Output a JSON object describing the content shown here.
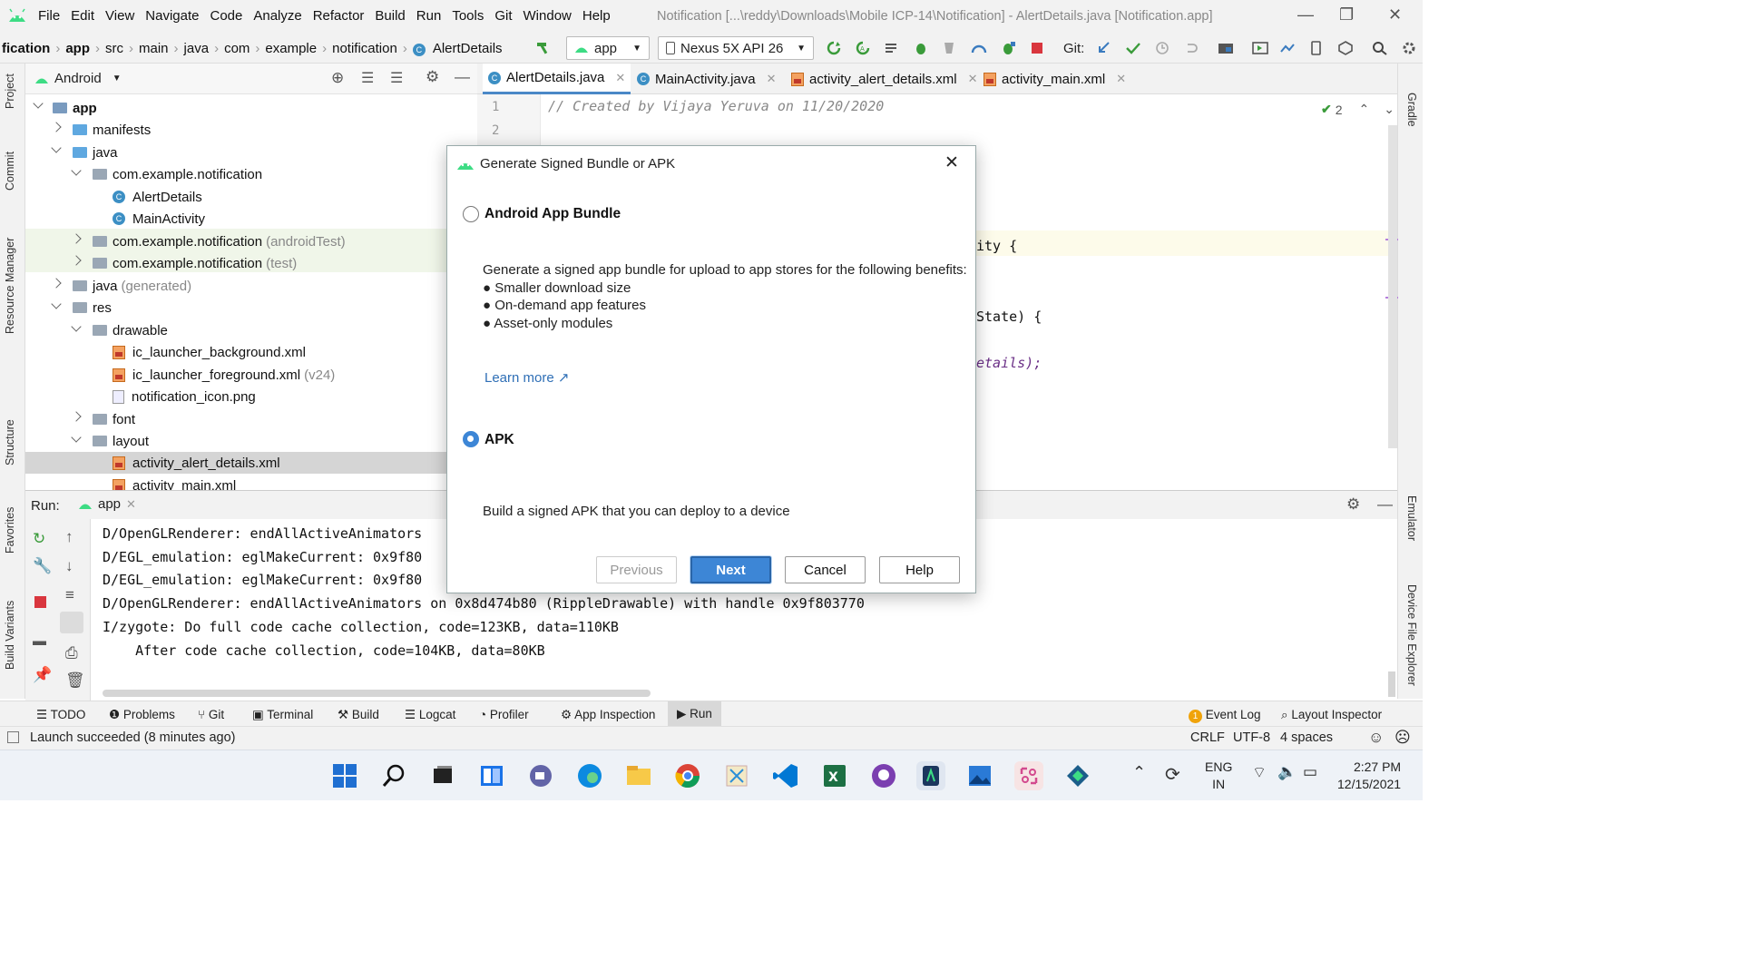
{
  "menubar": {
    "items": [
      "File",
      "Edit",
      "View",
      "Navigate",
      "Code",
      "Analyze",
      "Refactor",
      "Build",
      "Run",
      "Tools",
      "Git",
      "Window",
      "Help"
    ],
    "title": "Notification [...\\reddy\\Downloads\\Mobile ICP-14\\Notification] - AlertDetails.java [Notification.app]"
  },
  "navbar": {
    "breadcrumbs": [
      "fication",
      "app",
      "src",
      "main",
      "java",
      "com",
      "example",
      "notification",
      "AlertDetails"
    ],
    "run_config": "app",
    "device": "Nexus 5X API 26",
    "git_label": "Git:"
  },
  "left_strip": [
    "Project",
    "Commit",
    "Resource Manager",
    "Structure",
    "Favorites",
    "Build Variants"
  ],
  "right_strip": [
    "Gradle",
    "Emulator",
    "Device File Explorer"
  ],
  "project": {
    "view": "Android",
    "tree": [
      {
        "label": "app",
        "type": "module",
        "bold": true
      },
      {
        "label": "manifests",
        "type": "folder"
      },
      {
        "label": "java",
        "type": "folder"
      },
      {
        "label": "com.example.notification",
        "type": "package"
      },
      {
        "label": "AlertDetails",
        "type": "class"
      },
      {
        "label": "MainActivity",
        "type": "class"
      },
      {
        "label": "com.example.notification",
        "suffix": "(androidTest)",
        "type": "package"
      },
      {
        "label": "com.example.notification",
        "suffix": "(test)",
        "type": "package"
      },
      {
        "label": "java",
        "suffix": "(generated)",
        "type": "folder"
      },
      {
        "label": "res",
        "type": "folder"
      },
      {
        "label": "drawable",
        "type": "folder"
      },
      {
        "label": "ic_launcher_background.xml",
        "type": "xml"
      },
      {
        "label": "ic_launcher_foreground.xml",
        "suffix": "(v24)",
        "type": "xml"
      },
      {
        "label": "notification_icon.png",
        "type": "png"
      },
      {
        "label": "font",
        "type": "folder"
      },
      {
        "label": "layout",
        "type": "folder"
      },
      {
        "label": "activity_alert_details.xml",
        "type": "xml"
      },
      {
        "label": "activity_main.xml",
        "type": "xml"
      }
    ]
  },
  "editor": {
    "tabs": [
      "AlertDetails.java",
      "MainActivity.java",
      "activity_alert_details.xml",
      "activity_main.xml"
    ],
    "line_numbers": [
      "1",
      "2"
    ],
    "comment": "// Created by Vijaya Yeruva on 11/20/2020",
    "visible_fragments": [
      "ity {",
      "State) {",
      "etails);"
    ],
    "problems_count": "2"
  },
  "run": {
    "label": "Run:",
    "config": "app",
    "lines": [
      "D/OpenGLRenderer: endAllActiveAnimators",
      "D/EGL_emulation: eglMakeCurrent: 0x9f80",
      "D/EGL_emulation: eglMakeCurrent: 0x9f80",
      "D/OpenGLRenderer: endAllActiveAnimators on 0x8d474b80 (RippleDrawable) with handle 0x9f803770",
      "I/zygote: Do full code cache collection, code=123KB, data=110KB",
      "    After code cache collection, code=104KB, data=80KB"
    ]
  },
  "tool_windows": [
    "TODO",
    "Problems",
    "Git",
    "Terminal",
    "Build",
    "Logcat",
    "Profiler",
    "App Inspection",
    "Run"
  ],
  "tool_windows_right": {
    "event_log": "Event Log",
    "event_count": "1",
    "layout_inspector": "Layout Inspector"
  },
  "status": {
    "message": "Launch succeeded (8 minutes ago)",
    "line_sep": "CRLF",
    "encoding": "UTF-8",
    "indent": "4 spaces"
  },
  "dialog": {
    "title": "Generate Signed Bundle or APK",
    "option1_label": "Android App Bundle",
    "option1_desc": "Generate a signed app bundle for upload to app stores for the following benefits:",
    "benefits": [
      "Smaller download size",
      "On-demand app features",
      "Asset-only modules"
    ],
    "learn_more": "Learn more ↗",
    "option2_label": "APK",
    "option2_desc": "Build a signed APK that you can deploy to a device",
    "selected": "APK",
    "buttons": {
      "previous": "Previous",
      "next": "Next",
      "cancel": "Cancel",
      "help": "Help"
    }
  },
  "taskbar": {
    "lang": "ENG",
    "region": "IN",
    "time": "2:27 PM",
    "date": "12/15/2021"
  },
  "colors": {
    "accent": "#3d86d6",
    "android_green": "#3ddc84",
    "tab_highlight": "#4a88c7"
  }
}
